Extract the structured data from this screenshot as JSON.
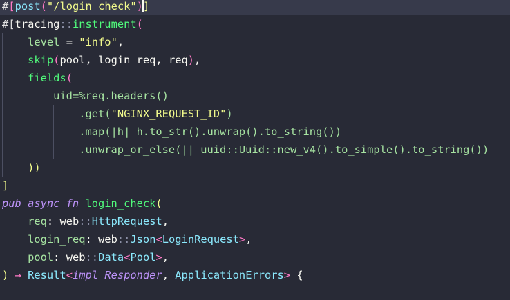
{
  "editor": {
    "lines": [
      {
        "tokens": [
          [
            "#",
            "#e0e0e0"
          ],
          [
            "[",
            "#ff79c6"
          ],
          [
            "post",
            "#8be9fd"
          ],
          [
            "(",
            "#ff79c6"
          ],
          [
            "\"/login_check\"",
            "#f1fa8c"
          ],
          [
            ")",
            "#ff79c6"
          ],
          [
            "]",
            "#f1fa8c"
          ]
        ]
      },
      {
        "tokens": [
          [
            "#[",
            "#e0e0e0"
          ],
          [
            "tracing",
            "#f8f8f2"
          ],
          [
            "::",
            "#8b8fa6"
          ],
          [
            "instrument",
            "#50fa7b"
          ],
          [
            "(",
            "#ff79c6"
          ]
        ]
      },
      {
        "tokens": [
          [
            "    ",
            ""
          ],
          [
            "level",
            "#a6e3a1"
          ],
          [
            " = ",
            "#f8f8f2"
          ],
          [
            "\"info\"",
            "#f1fa8c"
          ],
          [
            ",",
            "#f8f8f2"
          ]
        ]
      },
      {
        "tokens": [
          [
            "    ",
            ""
          ],
          [
            "skip",
            "#50fa7b"
          ],
          [
            "(",
            "#ff79c6"
          ],
          [
            "pool, login_req, req",
            "#f8f8f2"
          ],
          [
            ")",
            "#ff79c6"
          ],
          [
            ",",
            "#f8f8f2"
          ]
        ]
      },
      {
        "tokens": [
          [
            "    ",
            ""
          ],
          [
            "fields",
            "#50fa7b"
          ],
          [
            "(",
            "#ff79c6"
          ]
        ]
      },
      {
        "tokens": [
          [
            "        ",
            ""
          ],
          [
            "uid=%req.headers()",
            "#a6e3a1"
          ]
        ]
      },
      {
        "tokens": [
          [
            "            ",
            ""
          ],
          [
            ".get(",
            "#a6e3a1"
          ],
          [
            "\"NGINX_REQUEST_ID\"",
            "#f1fa8c"
          ],
          [
            ")",
            "#a6e3a1"
          ]
        ]
      },
      {
        "tokens": [
          [
            "            ",
            ""
          ],
          [
            ".map(|h| h.to_str().unwrap().to_string())",
            "#a6e3a1"
          ]
        ]
      },
      {
        "tokens": [
          [
            "            ",
            ""
          ],
          [
            ".unwrap_or_else(|| uuid::Uuid::new_v4().to_simple().to_string())",
            "#a6e3a1"
          ]
        ]
      },
      {
        "tokens": [
          [
            "    ",
            ""
          ],
          [
            "))",
            "#f1fa8c"
          ]
        ]
      },
      {
        "tokens": [
          [
            "]",
            "#f1fa8c"
          ]
        ]
      },
      {
        "tokens": [
          [
            "pub async fn",
            "#bd93f9i"
          ],
          [
            " ",
            ""
          ],
          [
            "login_check",
            "#50fa7b"
          ],
          [
            "(",
            "#f1fa8c"
          ]
        ]
      },
      {
        "tokens": [
          [
            "    ",
            ""
          ],
          [
            "req",
            "#a6e3a1"
          ],
          [
            ": ",
            "#f8f8f2"
          ],
          [
            "web",
            "#f8f8f2"
          ],
          [
            "::",
            "#8b8fa6"
          ],
          [
            "HttpRequest",
            "#8be9fd"
          ],
          [
            ",",
            "#f8f8f2"
          ]
        ]
      },
      {
        "tokens": [
          [
            "    ",
            ""
          ],
          [
            "login_req",
            "#a6e3a1"
          ],
          [
            ": ",
            "#f8f8f2"
          ],
          [
            "web",
            "#f8f8f2"
          ],
          [
            "::",
            "#8b8fa6"
          ],
          [
            "Json",
            "#8be9fd"
          ],
          [
            "<",
            "#ff79c6"
          ],
          [
            "LoginRequest",
            "#8be9fd"
          ],
          [
            ">",
            "#ff79c6"
          ],
          [
            ",",
            "#f8f8f2"
          ]
        ]
      },
      {
        "tokens": [
          [
            "    ",
            ""
          ],
          [
            "pool",
            "#a6e3a1"
          ],
          [
            ": ",
            "#f8f8f2"
          ],
          [
            "web",
            "#f8f8f2"
          ],
          [
            "::",
            "#8b8fa6"
          ],
          [
            "Data",
            "#8be9fd"
          ],
          [
            "<",
            "#ff79c6"
          ],
          [
            "Pool",
            "#8be9fd"
          ],
          [
            ">",
            "#ff79c6"
          ],
          [
            ",",
            "#f8f8f2"
          ]
        ]
      },
      {
        "tokens": [
          [
            ") ",
            "#f1fa8c"
          ],
          [
            "→ ",
            "#ff79c6"
          ],
          [
            "Result",
            "#8be9fd"
          ],
          [
            "<",
            "#ff79c6"
          ],
          [
            "impl Responder",
            "#bd93f9i"
          ],
          [
            ", ",
            "#f8f8f2"
          ],
          [
            "ApplicationErrors",
            "#8be9fd"
          ],
          [
            ">",
            "#ff79c6"
          ],
          [
            " {",
            "#f8f8f2"
          ]
        ]
      }
    ]
  }
}
